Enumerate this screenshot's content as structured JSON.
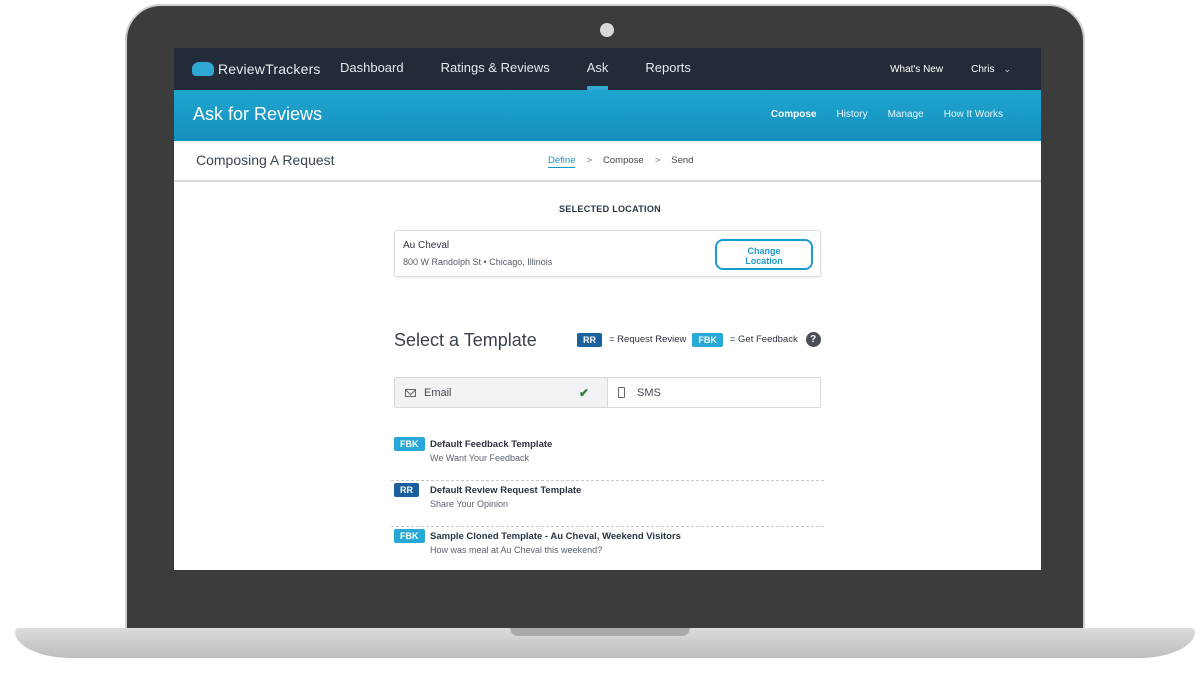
{
  "brand": {
    "name": "ReviewTrackers"
  },
  "topnav": {
    "links": [
      "Dashboard",
      "Ratings & Reviews",
      "Ask",
      "Reports"
    ],
    "active": "Ask",
    "whats_new": "What's New",
    "user": "Chris"
  },
  "subheader": {
    "title": "Ask for Reviews",
    "links": [
      "Compose",
      "History",
      "Manage",
      "How It Works"
    ]
  },
  "steps": {
    "title": "Composing A Request",
    "items": [
      "Define",
      "Compose",
      "Send"
    ],
    "separator": ">"
  },
  "location": {
    "label": "SELECTED LOCATION",
    "name": "Au Cheval",
    "address": "800 W Randolph St • Chicago, Illinois",
    "change_label_1": "Change",
    "change_label_2": "Location"
  },
  "templates": {
    "title": "Select a Template",
    "legend": {
      "rr_badge": "RR",
      "rr_text": "= Request Review",
      "fbk_badge": "FBK",
      "fbk_text": "= Get Feedback",
      "help": "?"
    },
    "channels": {
      "email": "Email",
      "sms": "SMS",
      "selected": "Email"
    },
    "items": [
      {
        "badge": "FBK",
        "name": "Default Feedback Template",
        "subject": "We Want Your Feedback"
      },
      {
        "badge": "RR",
        "name": "Default Review Request Template",
        "subject": "Share Your Opinion"
      },
      {
        "badge": "FBK",
        "name": "Sample Cloned Template - Au Cheval, Weekend Visitors",
        "subject": "How was meal at Au Cheval this weekend?"
      }
    ]
  },
  "colors": {
    "nav_bg": "#232b38",
    "accent_blue": "#1fa5d0",
    "rr_badge": "#1b5f9e",
    "fbk_badge": "#27a8d6"
  }
}
